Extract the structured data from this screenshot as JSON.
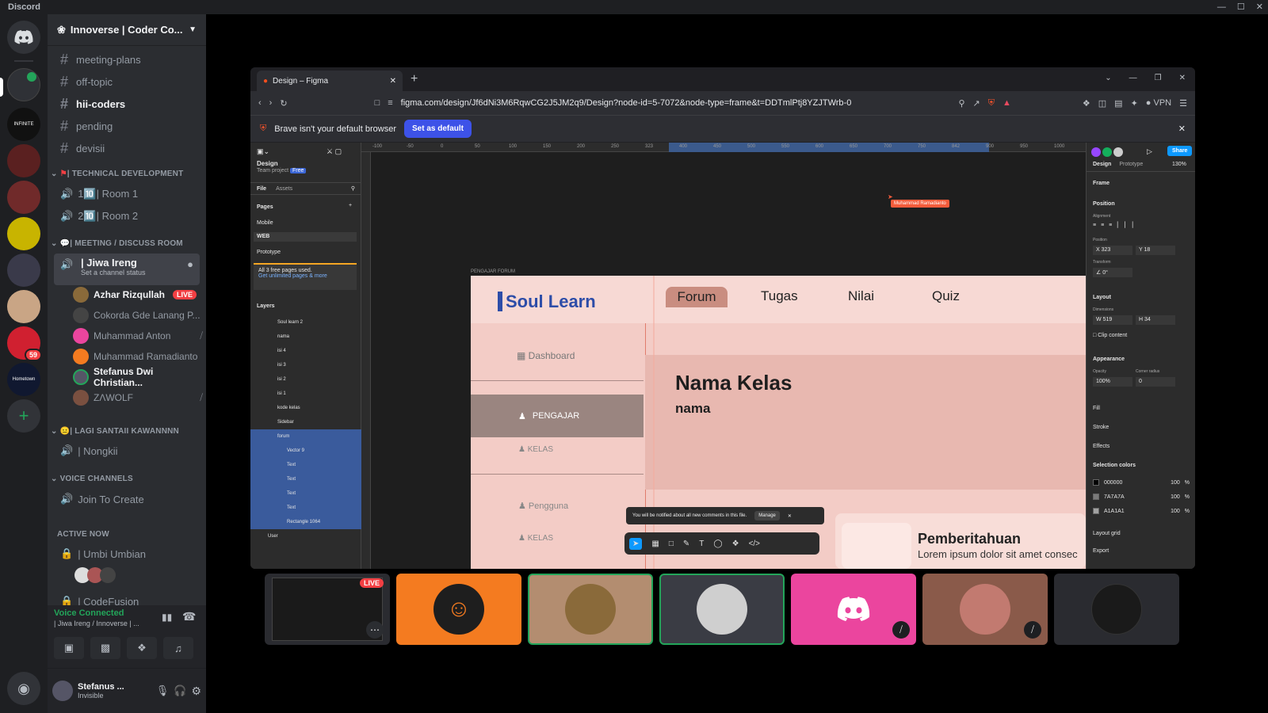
{
  "app": {
    "title": "Discord"
  },
  "servers": [
    {
      "name": "discord-home",
      "label": "",
      "color": "#313338"
    },
    {
      "name": "server-1",
      "label": "",
      "color": "#2f3136",
      "badge": ""
    },
    {
      "name": "server-infinite",
      "label": "INFINITE",
      "color": "#111"
    },
    {
      "name": "server-3",
      "label": "",
      "color": "#5a2020"
    },
    {
      "name": "server-4",
      "label": "",
      "color": "#702a2a"
    },
    {
      "name": "server-5",
      "label": "",
      "color": "#c8b400"
    },
    {
      "name": "server-6",
      "label": "",
      "color": "#3a3a4a"
    },
    {
      "name": "server-7",
      "label": "",
      "color": "#c9a585"
    },
    {
      "name": "server-8",
      "label": "",
      "color": "#d02030",
      "badge": "59"
    },
    {
      "name": "server-9",
      "label": "Hometown",
      "color": "#101830"
    }
  ],
  "guild": {
    "name": "Innoverse | Coder Co..."
  },
  "channels": {
    "text": [
      "meeting-plans",
      "off-topic",
      "hii-coders",
      "pending",
      "devisii"
    ],
    "cat_tech": "| TECHNICAL DEVELOPMENT",
    "tech_rooms": [
      "1🔟| Room 1",
      "2🔟| Room 2"
    ],
    "cat_meeting": "| MEETING / DISCUSS ROOM",
    "jiwa": "| Jiwa Ireng",
    "jiwa_status": "Set a channel status",
    "users": [
      {
        "name": "Azhar Rizqullah",
        "live": "LIVE",
        "color": "#8a6a3a"
      },
      {
        "name": "Cokorda Gde Lanang P...",
        "color": "#444"
      },
      {
        "name": "Muhammad Anton",
        "color": "#eb459e"
      },
      {
        "name": "Muhammad Ramadianto",
        "color": "#f47b20"
      },
      {
        "name": "Stefanus Dwi Christian...",
        "color": "#556"
      },
      {
        "name": "ZΛWOLF",
        "color": "#7a5040"
      }
    ],
    "cat_lagi": "| LAGI SANTAII KAWANNNN",
    "nongkii": "| Nongkii",
    "cat_voice": "VOICE CHANNELS",
    "join": "Join To Create",
    "cat_active": "ACTIVE NOW",
    "umbi": "| Umbi Umbian",
    "codefusion": "| CodeFusion"
  },
  "voice": {
    "status": "Voice Connected",
    "location": "| Jiwa Ireng / Innoverse | ..."
  },
  "user": {
    "name": "Stefanus ...",
    "status": "Invisible"
  },
  "browser": {
    "tab_title": "Design – Figma",
    "url": "figma.com/design/Jf6dNi3M6RqwCG2J5JM2q9/Design?node-id=5-7072&node-type=frame&t=DDTmlPtj8YZJTWrb-0",
    "info_text": "Brave isn't your default browser",
    "info_button": "Set as default",
    "vpn": "VPN"
  },
  "figma": {
    "file_label": "Design",
    "team": "Team project",
    "plan": "Free",
    "tabs": [
      "File",
      "Assets"
    ],
    "pages_label": "Pages",
    "pages": [
      "Mobile",
      "WEB",
      "Prototype"
    ],
    "upgrade_line1": "All 3 free pages used.",
    "upgrade_line2": "Get unlimited pages & more",
    "layers_label": "Layers",
    "layers": [
      "Soul learn 2",
      "nama",
      "isi 4",
      "isi 3",
      "isi 2",
      "isi 1",
      "kode kelas",
      "Sidebar",
      "forum",
      "Vector 9",
      "Text",
      "Text",
      "Text",
      "Text",
      "Rectangle 1064",
      "User"
    ],
    "frame_label": "PENGAJAR FORUM",
    "cursor_name": "Muhammad Ramadianto",
    "logo": "Soul Learn",
    "nav": [
      "Forum",
      "Tugas",
      "Nilai",
      "Quiz"
    ],
    "sidebar": [
      "Dashboard",
      "PENGAJAR",
      "KELAS",
      "Pengguna",
      "KELAS"
    ],
    "class_title": "Nama Kelas",
    "class_sub": "nama",
    "notif_title": "Pemberitahuan",
    "notif_text": "Lorem ipsum dolor sit amet consec",
    "toast": "You will be notified about all new comments in this file.",
    "toast_btn": "Manage",
    "right": {
      "tabs": [
        "Design",
        "Prototype"
      ],
      "zoom": "130%",
      "share": "Share",
      "frame": "Frame",
      "position": "Position",
      "alignment": "Alignment",
      "pos_label": "Position",
      "x": "323",
      "y": "18",
      "transform": "Transform",
      "rot": "0°",
      "layout": "Layout",
      "dimensions": "Dimensions",
      "w": "519",
      "h": "34",
      "clip": "Clip content",
      "appearance": "Appearance",
      "opacity_lbl": "Opacity",
      "radius_lbl": "Corner radius",
      "opacity": "100%",
      "radius": "0",
      "fill": "Fill",
      "stroke": "Stroke",
      "effects": "Effects",
      "sel_colors": "Selection colors",
      "colors": [
        {
          "hex": "000000",
          "pct": "100",
          "swatch": "#000000"
        },
        {
          "hex": "7A7A7A",
          "pct": "100",
          "swatch": "#7a7a7a"
        },
        {
          "hex": "A1A1A1",
          "pct": "100",
          "swatch": "#a1a1a1"
        }
      ],
      "layout_grid": "Layout grid",
      "export": "Export"
    },
    "ruler_marks": [
      "-100",
      "-50",
      "0",
      "50",
      "100",
      "150",
      "200",
      "250",
      "323",
      "400",
      "450",
      "500",
      "550",
      "600",
      "650",
      "700",
      "750",
      "842",
      "900",
      "950",
      "1000"
    ]
  },
  "call_tiles": [
    {
      "name": "screen-share-tile",
      "bg": "#222",
      "live": "LIVE"
    },
    {
      "name": "tile-orange",
      "bg": "#f47b20"
    },
    {
      "name": "tile-cat",
      "bg": "#b38d70"
    },
    {
      "name": "tile-bw",
      "bg": "#3a3c44"
    },
    {
      "name": "tile-discord",
      "bg": "#eb459e"
    },
    {
      "name": "tile-girl",
      "bg": "#8a5a4a"
    },
    {
      "name": "tile-dark",
      "bg": "#2a2b30"
    }
  ],
  "colors": {
    "accent": "#5865f2",
    "green": "#23a55a",
    "red": "#f23f43"
  }
}
